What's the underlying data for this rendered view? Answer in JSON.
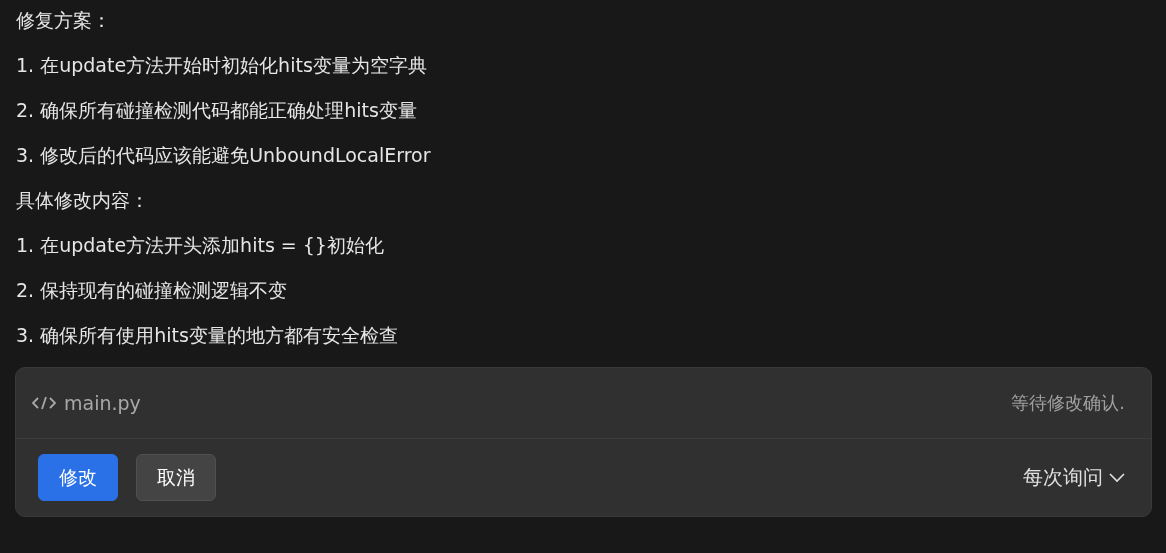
{
  "lines": [
    "修复方案：",
    "1. 在update方法开始时初始化hits变量为空字典",
    "2. 确保所有碰撞检测代码都能正确处理hits变量",
    "3. 修改后的代码应该能避免UnboundLocalError",
    "具体修改内容：",
    "1. 在update方法开头添加hits = {}初始化",
    "2. 保持现有的碰撞检测逻辑不变",
    "3. 确保所有使用hits变量的地方都有安全检查"
  ],
  "card": {
    "filename": "main.py",
    "status": "等待修改确认.",
    "buttons": [
      {
        "label": "修改",
        "kind": "primary"
      },
      {
        "label": "取消",
        "kind": "secondary"
      }
    ],
    "mode": "每次询问"
  }
}
